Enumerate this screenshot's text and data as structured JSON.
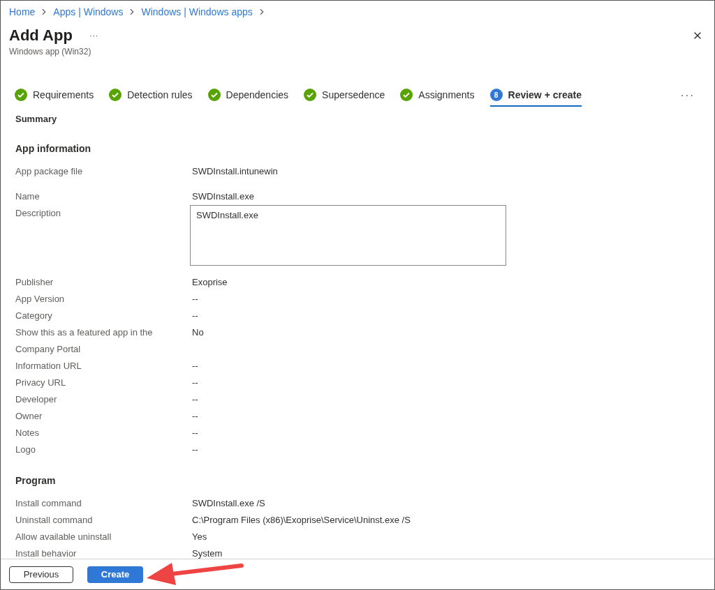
{
  "breadcrumb": [
    "Home",
    "Apps | Windows",
    "Windows | Windows apps"
  ],
  "title": "Add App",
  "more": "···",
  "subtitle": "Windows app (Win32)",
  "steps": [
    {
      "label": "Requirements",
      "kind": "done",
      "selected": false
    },
    {
      "label": "Detection rules",
      "kind": "done",
      "selected": false
    },
    {
      "label": "Dependencies",
      "kind": "done",
      "selected": false
    },
    {
      "label": "Supersedence",
      "kind": "done",
      "selected": false
    },
    {
      "label": "Assignments",
      "kind": "done",
      "selected": false
    },
    {
      "label": "Review + create",
      "kind": "current",
      "number": "8",
      "selected": true
    }
  ],
  "steps_more": "···",
  "summary": "Summary",
  "sections": [
    {
      "heading": "App information",
      "rows": [
        {
          "label": "App package file",
          "value": "SWDInstall.intunewin"
        },
        {
          "label": "Name",
          "value": "SWDInstall.exe"
        },
        {
          "label": "Description",
          "value": "SWDInstall.exe",
          "kind": "textarea"
        },
        {
          "label": "Publisher",
          "value": "Exoprise"
        },
        {
          "label": "App Version",
          "value": "--"
        },
        {
          "label": "Category",
          "value": "--"
        },
        {
          "label": "Show this as a featured app in the Company Portal",
          "value": "No"
        },
        {
          "label": "Information URL",
          "value": "--"
        },
        {
          "label": "Privacy URL",
          "value": "--"
        },
        {
          "label": "Developer",
          "value": "--"
        },
        {
          "label": "Owner",
          "value": "--"
        },
        {
          "label": "Notes",
          "value": "--"
        },
        {
          "label": "Logo",
          "value": "--"
        }
      ]
    },
    {
      "heading": "Program",
      "rows": [
        {
          "label": "Install command",
          "value": "SWDInstall.exe /S"
        },
        {
          "label": "Uninstall command",
          "value": "C:\\Program Files (x86)\\Exoprise\\Service\\Uninst.exe /S"
        },
        {
          "label": "Allow available uninstall",
          "value": "Yes"
        },
        {
          "label": "Install behavior",
          "value": "System"
        }
      ]
    }
  ],
  "buttons": [
    {
      "label": "Previous",
      "kind": "secondary"
    },
    {
      "label": "Create",
      "kind": "primary"
    }
  ]
}
